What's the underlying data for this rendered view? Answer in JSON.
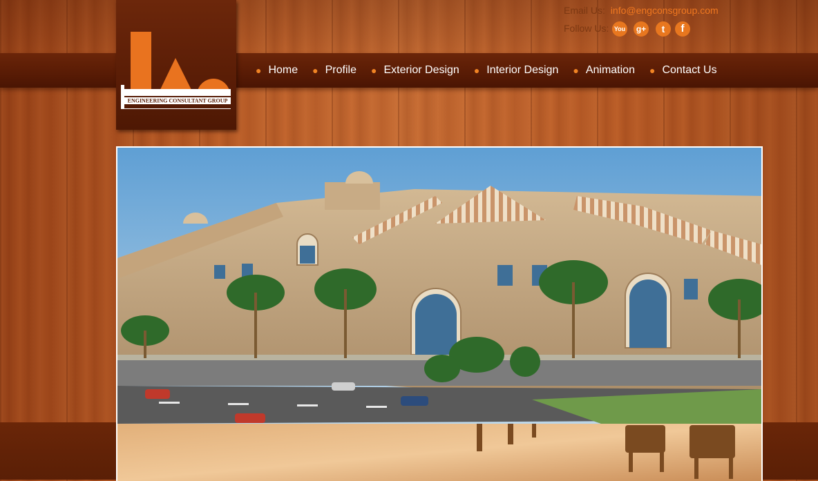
{
  "header": {
    "logo": {
      "caption": "ENGINEERING CONSULTANT GROUP",
      "shapes_color": "#e9731f"
    },
    "email_label": "Email Us:",
    "email_value": "info@engconsgroup.com",
    "follow_label": "Follow Us:",
    "social": [
      {
        "icon": "youtube-icon",
        "glyph": "You"
      },
      {
        "icon": "google-plus-icon",
        "glyph": "g+"
      },
      {
        "icon": "twitter-icon",
        "glyph": "t"
      },
      {
        "icon": "facebook-icon",
        "glyph": "f"
      }
    ]
  },
  "nav": {
    "items": [
      {
        "label": "Home"
      },
      {
        "label": "Profile"
      },
      {
        "label": "Exterior Design"
      },
      {
        "label": "Interior Design"
      },
      {
        "label": "Animation"
      },
      {
        "label": "Contact Us"
      }
    ],
    "bullet_color": "#f08424"
  },
  "colors": {
    "accent": "#f07820",
    "nav_bg": "#5a1c05",
    "wood": "#b8602a"
  },
  "hero": {
    "image": "architectural-rendering-building"
  }
}
